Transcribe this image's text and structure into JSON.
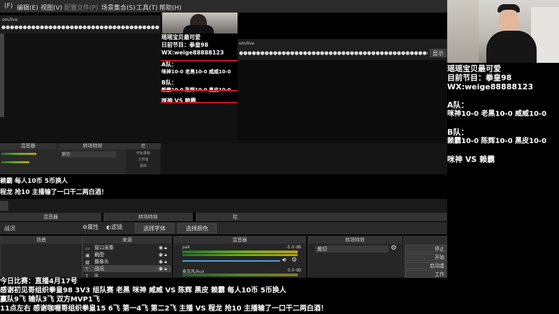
{
  "menu": [
    "(F)",
    "编辑(E)",
    "视图(V)",
    "配置文件(P)",
    "场景集合(S)",
    "工具(T)",
    "帮助(H)"
  ],
  "url_fragment_1": "om/live",
  "url_fragment_2": "om/live",
  "show_btn": "显示",
  "overlay": {
    "line1": "瑶瑶宝贝最可爱",
    "line2": "日前节目：拳皇98",
    "line3": "WX:weige88888123",
    "team_a": "A队：",
    "team_a_players": "咪神10-0 老黑10-0 威威10-0",
    "team_b": "B队：",
    "team_b_players": "赖霸10-0 陈辉10-0 黑皮10-0",
    "vs": "咪神 VS 赖霸"
  },
  "right_panel": {
    "line1": "瑶瑶宝贝最可爱",
    "line2": "目前节目：拳皇98",
    "line3": "WX:weige88888123",
    "team_a": "A队：",
    "team_a_players": "咪神10-0 老黑10-0 威威10-0",
    "team_b": "B队：",
    "team_b_players": "赖霸10-0 陈辉10-0 黑皮10-0",
    "vs": "咪神 VS 赖霸"
  },
  "ticker": {
    "line1": "赖霸 每人10币 5币换人",
    "line2": "程龙 抢10 主播输了一口干二两白酒！"
  },
  "obs_small": {
    "mixer": "混音器",
    "transition": "转场特效",
    "fade": "渐切",
    "controls": "控",
    "settings": "设置",
    "start_record": "开始录制",
    "studio": "工作室",
    "exit": "退出"
  },
  "obs_main": {
    "mixer_header": "混音器",
    "transition_header": "转场特效",
    "control_header": "控",
    "source_name": "战况",
    "properties": "属性",
    "filters": "滤镜",
    "select_font": "选择字体",
    "select_color": "选择颜色",
    "scenes_header": "场景",
    "sources_header": "来源",
    "sources": [
      "窗口采集",
      "截图",
      "摄像头",
      "战况",
      "ik"
    ],
    "audio_desktop": "pak",
    "audio_desktop_db": "-5.0 dB",
    "audio_mic": "麦克风/Aux",
    "audio_mic_db": "0.0 dB",
    "transition_value": "裁切",
    "stop_stream": "停止",
    "start_record": "开始",
    "studio_mode": "启动虚",
    "studio": "工作"
  },
  "bottom_text": {
    "line1": "今日比赛：直播4月17号",
    "line2": "感谢初见哥组织拳皇98 3V3 组队赛 老黑 咪神 威威 VS 陈辉 黑皮 赖霸 每人10币 5币换人",
    "line3": "赢队9飞 输队3飞 双方MVP1飞",
    "line4": "11点左右 感谢咖喱哥组织拳皇15 6飞 第一4飞 第二2飞 主播 VS 程龙 抢10 主播输了一口干二两白酒！"
  }
}
